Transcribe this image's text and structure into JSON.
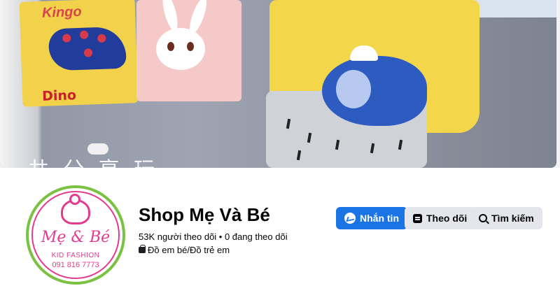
{
  "page": {
    "name": "Shop Mẹ Và Bé",
    "stats": "53K người theo dõi • 0 đang theo dõi",
    "category": "Đồ em bé/Đồ trẻ em"
  },
  "avatar": {
    "brand_name": "Mẹ & Bé",
    "brand_sub": "KID FASHION",
    "brand_phone": "091 816 7773"
  },
  "cover": {
    "text_dino": "Dino",
    "text_kingo": "Kingo",
    "text_chinese": "共 分 享 玩"
  },
  "actions": {
    "message_label": "Nhắn tin",
    "follow_label": "Theo dõi",
    "search_label": "Tìm kiếm"
  },
  "colors": {
    "primary": "#1b74e4",
    "secondary_button": "#e4e6eb",
    "brand_pink": "#e53b8e",
    "brand_green": "#7cc242"
  },
  "icons": {
    "message": "messenger-icon",
    "follow": "follow-icon",
    "search": "search-icon",
    "category": "bag-icon"
  }
}
